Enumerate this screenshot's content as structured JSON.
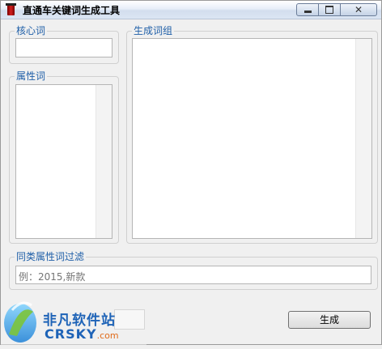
{
  "window": {
    "title": "直通车关键词生成工具"
  },
  "core_group": {
    "legend": "核心词",
    "value": ""
  },
  "attr_group": {
    "legend": "属性词"
  },
  "result_group": {
    "legend": "生成词组"
  },
  "filter_group": {
    "legend": "同类属性词过滤",
    "placeholder": "例：2015,新款"
  },
  "generate_button": {
    "label": "生成"
  },
  "watermark": {
    "brand_cn": "非凡软件站",
    "brand_en": "CRSKY",
    "domain_suffix": ".com"
  },
  "colors": {
    "legend_text": "#1f5fa8",
    "background": "#f0f0f0"
  }
}
